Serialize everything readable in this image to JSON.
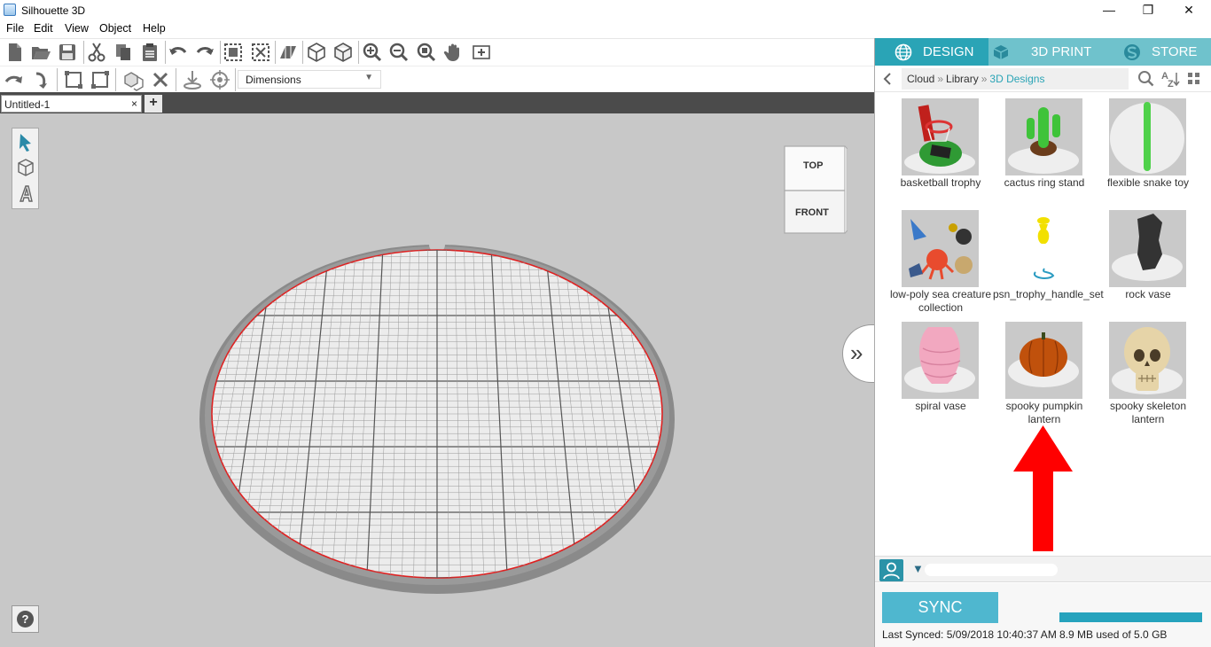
{
  "window": {
    "title": "Silhouette 3D",
    "minimize": "—",
    "maximize": "❐",
    "close": "✕"
  },
  "menu": [
    "File",
    "Edit",
    "View",
    "Object",
    "Help"
  ],
  "toolbar2": {
    "dimensions_select": "Dimensions"
  },
  "tabs": {
    "document": "Untitled-1",
    "close": "×",
    "add": "+"
  },
  "view_cube": {
    "top": "TOP",
    "front": "FRONT"
  },
  "panel": {
    "tabs": [
      {
        "label": "DESIGN",
        "active": true
      },
      {
        "label": "3D PRINT",
        "active": false
      },
      {
        "label": "STORE",
        "active": false
      }
    ],
    "breadcrumb": [
      "Cloud",
      "Library",
      "3D Designs"
    ],
    "items": [
      {
        "label": "basketball trophy"
      },
      {
        "label": "cactus ring stand"
      },
      {
        "label": "flexible snake toy"
      },
      {
        "label": "low-poly sea creature collection"
      },
      {
        "label": "psn_trophy_handle_set"
      },
      {
        "label": "rock vase"
      },
      {
        "label": "spiral vase"
      },
      {
        "label": "spooky pumpkin lantern"
      },
      {
        "label": "spooky skeleton lantern"
      }
    ],
    "sync": {
      "button": "SYNC",
      "last_synced": "Last Synced: 5/09/2018 10:40:37 AM",
      "storage_used": "8.9 MB used of 5.0 GB"
    }
  },
  "colors": {
    "accent": "#2aa4b6",
    "accent_light": "#6fc2cc",
    "annotation_arrow": "#ff0000",
    "canvas": "#c8c8c8"
  }
}
